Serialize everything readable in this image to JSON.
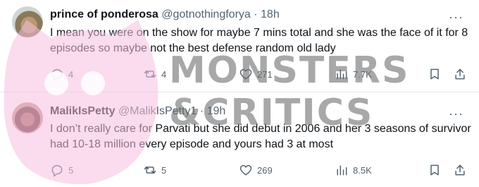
{
  "tweets": [
    {
      "name": "prince of ponderosa",
      "handle": "@gotnothingforya",
      "separator": "·",
      "time": "18h",
      "text": "I mean you were on the show for maybe 7 mins total and she was the face of it for 8 episodes so maybe not the best defense random old lady",
      "reply_count": "4",
      "retweet_count": "4",
      "like_count": "271",
      "view_count": "7.7K"
    },
    {
      "name": "MalikIsPetty",
      "handle": "@MalikIsPetty1",
      "separator": "·",
      "time": "19h",
      "text": "I don’t really care for Parvati but she did debut in 2006 and her 3 seasons of survivor had 10-18 million every episode and yours had 3 at most",
      "reply_count": "5",
      "retweet_count": "5",
      "like_count": "269",
      "view_count": "8.5K"
    }
  ],
  "watermark": {
    "line1": "MONSTERS",
    "line2": "&CRITICS",
    "blob_color": "#f6bfe0"
  },
  "icons": [
    "more-icon",
    "reply-icon",
    "retweet-icon",
    "like-icon",
    "views-icon",
    "bookmark-icon",
    "share-icon"
  ]
}
